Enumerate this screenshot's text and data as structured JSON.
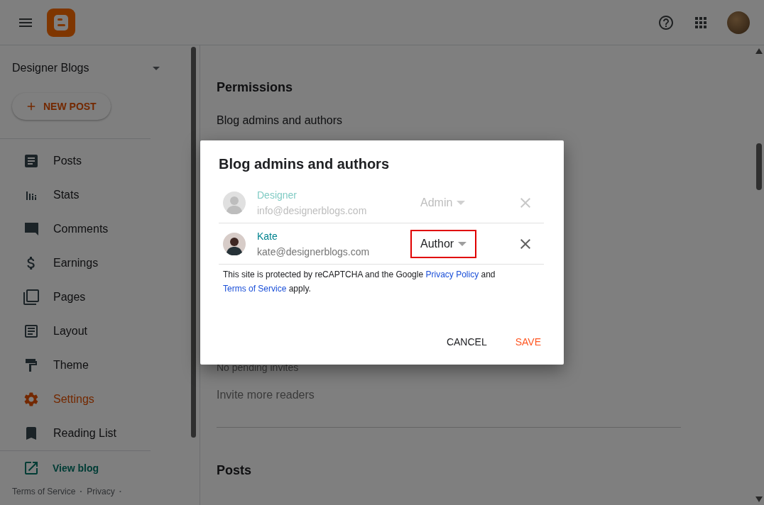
{
  "sidebar": {
    "blog_name": "Designer Blogs",
    "new_post": "NEW POST",
    "items": [
      {
        "label": "Posts",
        "kind": "posts",
        "selected": false
      },
      {
        "label": "Stats",
        "kind": "stats",
        "selected": false
      },
      {
        "label": "Comments",
        "kind": "comments",
        "selected": false
      },
      {
        "label": "Earnings",
        "kind": "earnings",
        "selected": false
      },
      {
        "label": "Pages",
        "kind": "pages",
        "selected": false
      },
      {
        "label": "Layout",
        "kind": "layout",
        "selected": false
      },
      {
        "label": "Theme",
        "kind": "theme",
        "selected": false
      },
      {
        "label": "Settings",
        "kind": "settings",
        "selected": true
      },
      {
        "label": "Reading List",
        "kind": "reading",
        "selected": false
      }
    ],
    "view_blog": "View blog",
    "footer": [
      {
        "kind": "link",
        "text": "Terms of Service"
      },
      {
        "kind": "separator",
        "text": "·"
      },
      {
        "kind": "link",
        "text": "Privacy"
      },
      {
        "kind": "separator",
        "text": "·"
      }
    ]
  },
  "main": {
    "section_title": "Permissions",
    "subsection": "Blog admins and authors",
    "pending": "No pending invites",
    "invite": "Invite more readers",
    "next_section": "Posts"
  },
  "dialog": {
    "title": "Blog admins and authors",
    "members": [
      {
        "name": "Designer",
        "email": "info@designerblogs.com",
        "role": "Admin",
        "disabled": true,
        "highlighted": false
      },
      {
        "name": "Kate",
        "email": "kate@designerblogs.com",
        "role": "Author",
        "disabled": false,
        "highlighted": true
      }
    ],
    "notice": [
      {
        "kind": "text",
        "text": "This site is protected by reCAPTCHA and the Google "
      },
      {
        "kind": "link",
        "text": "Privacy Policy"
      },
      {
        "kind": "text",
        "text": " and "
      },
      {
        "kind": "link",
        "text": "Terms of Service"
      },
      {
        "kind": "text",
        "text": " apply."
      }
    ],
    "buttons": [
      {
        "label": "CANCEL",
        "kind": "secondary"
      },
      {
        "label": "SAVE",
        "kind": "primary"
      }
    ]
  }
}
